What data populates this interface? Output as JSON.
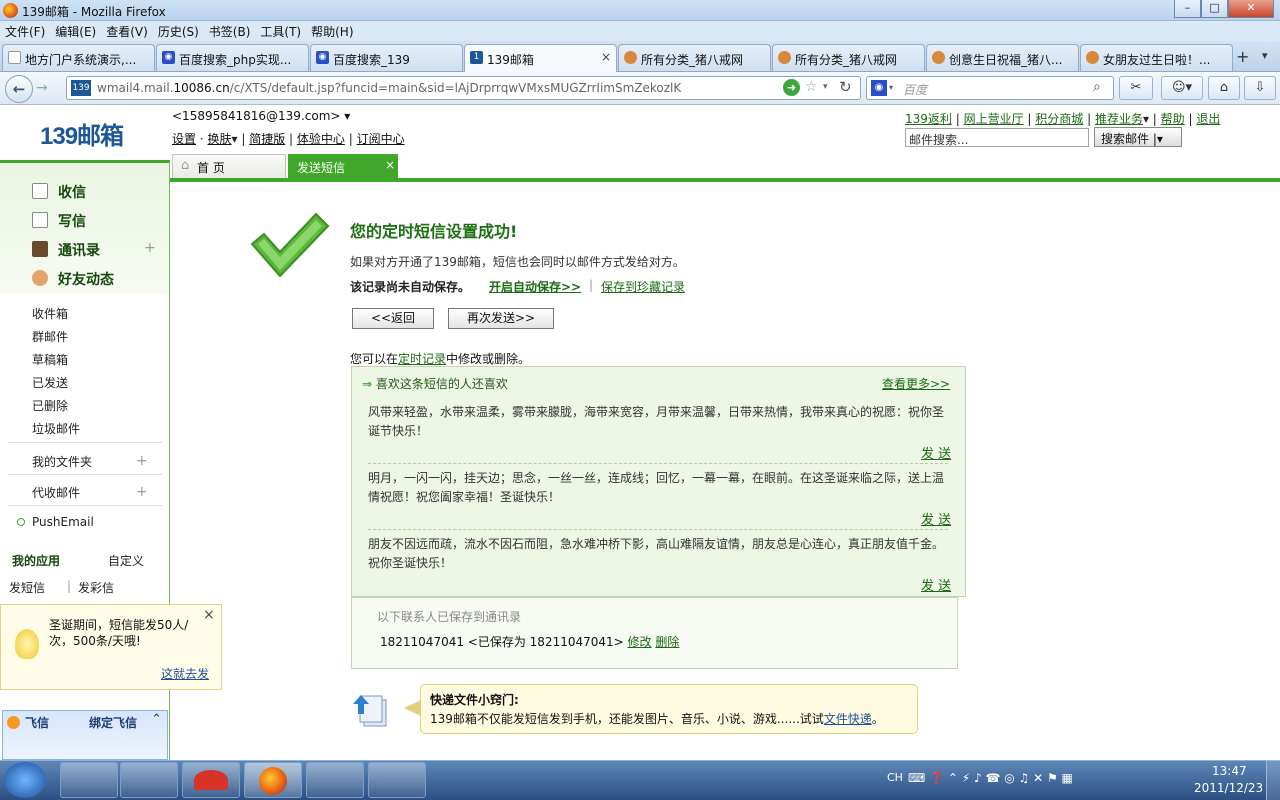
{
  "window": {
    "title": "139邮箱 - Mozilla Firefox",
    "min": "–",
    "max": "□",
    "close": "✕"
  },
  "menu": [
    "文件(F)",
    "编辑(E)",
    "查看(V)",
    "历史(S)",
    "书签(B)",
    "工具(T)",
    "帮助(H)"
  ],
  "tabs": [
    {
      "label": "地方门户系统演示,...",
      "icon": "page-icon"
    },
    {
      "label": "百度搜索_php实现...",
      "icon": "baidu-paw-icon"
    },
    {
      "label": "百度搜索_139",
      "icon": "baidu-paw-icon"
    },
    {
      "label": "139邮箱",
      "icon": "139-icon"
    },
    {
      "label": "所有分类_猪八戒网",
      "icon": "zbj-icon"
    },
    {
      "label": "所有分类_猪八戒网",
      "icon": "zbj-icon"
    },
    {
      "label": "创意生日祝福_猪八...",
      "icon": "zbj-icon"
    },
    {
      "label": "女朋友过生日啦！...",
      "icon": "zbj-icon"
    }
  ],
  "tab_close": "×",
  "tab_new": "+",
  "url": {
    "prefix": "wmail4.mail.",
    "host": "10086.cn",
    "path": "/c/XTS/default.jsp?funcid=main&sid=lAjDrprrqwVMxsMUGZrrIimSmZekozlK"
  },
  "search_placeholder": "百度",
  "mail": {
    "logo": "139邮箱",
    "account": "<15895841816@139.com>",
    "top_links": [
      "设置",
      "换肤",
      "简捷版",
      "体验中心",
      "订阅中心"
    ],
    "right_links": [
      "139返利",
      "网上营业厅",
      "积分商城",
      "推荐业务",
      "帮助",
      "退出"
    ],
    "search_input": "邮件搜索...",
    "search_button": "搜索邮件",
    "page_tabs": {
      "home": "首 页",
      "sms": "发送短信",
      "close": "×"
    }
  },
  "sidebar": {
    "main": [
      "收信",
      "写信",
      "通讯录",
      "好友动态"
    ],
    "folders": [
      "收件箱",
      "群邮件",
      "草稿箱",
      "已发送",
      "已删除",
      "垃圾邮件"
    ],
    "my_folders": "我的文件夹",
    "proxy": "代收邮件",
    "push": "PushEmail",
    "apps_title": "我的应用",
    "apps_custom": "自定义",
    "apps": [
      "发短信",
      "发彩信"
    ],
    "tip": {
      "text": "圣诞期间，短信能发50人/次，500条/天哦!",
      "link": "这就去发"
    },
    "feixin": {
      "name": "飞信",
      "bind": "绑定飞信"
    }
  },
  "content": {
    "title": "您的定时短信设置成功!",
    "note": "如果对方开通了139邮箱，短信也会同时以邮件方式发给对方。",
    "not_saved": "该记录尚未自动保存。",
    "auto_save": "开启自动保存>>",
    "save_collection": "保存到珍藏记录",
    "back": "<<返回",
    "resend": "再次发送>>",
    "edit_pre": "您可以在",
    "edit_link": "定时记录",
    "edit_post": "中修改或删除。",
    "like_title": "喜欢这条短信的人还喜欢",
    "more": "查看更多>>",
    "sms_list": [
      "风带来轻盈，水带来温柔，雾带来朦胧，海带来宽容，月带来温馨，日带来热情，我带来真心的祝愿：祝你圣诞节快乐！",
      "明月，一闪一闪，挂天边；思念，一丝一丝，连成线；回忆，一幕一幕，在眼前。在这圣诞来临之际，送上温情祝愿！祝您阖家幸福！圣诞快乐！",
      "朋友不因远而疏，流水不因石而阻，急水难冲桥下影，高山难隔友谊情，朋友总是心连心，真正朋友值千金。祝你圣诞快乐！"
    ],
    "send": "发 送",
    "saved_title": "以下联系人已保存到通讯录",
    "saved_entry": "18211047041 <已保存为 18211047041>",
    "edit": "修改",
    "delete": "删除",
    "tipbox": {
      "title": "快递文件小窍门:",
      "text": "139邮箱不仅能发短信发到手机，还能发图片、音乐、小说、游戏......试试",
      "link": "文件快递",
      "end": "。"
    }
  },
  "taskbar": {
    "time": "13:47",
    "date": "2011/12/23",
    "ime": "CH"
  },
  "colors": {
    "accent_green": "#3fa72a",
    "link_green": "#1a6b12",
    "brand_blue": "#1e5797"
  }
}
